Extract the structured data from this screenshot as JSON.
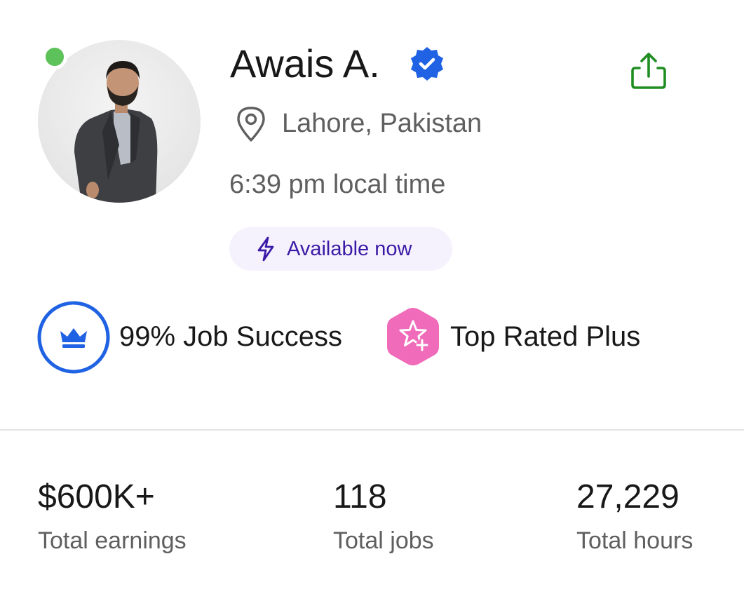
{
  "profile": {
    "name": "Awais A.",
    "location": "Lahore, Pakistan",
    "local_time": "6:39 pm local time",
    "availability": "Available now",
    "online": true,
    "verified": true
  },
  "badges": {
    "job_success": "99% Job Success",
    "job_success_fraction": 0.99,
    "top_rated": "Top Rated Plus"
  },
  "stats": [
    {
      "value": "$600K+",
      "label": "Total earnings"
    },
    {
      "value": "118",
      "label": "Total jobs"
    },
    {
      "value": "27,229",
      "label": "Total hours"
    }
  ],
  "icons": {
    "verified": "verified-badge-icon",
    "share": "share-icon",
    "location": "map-pin-icon",
    "availability": "lightning-bolt-icon",
    "job_success": "crown-icon",
    "top_rated": "star-plus-icon"
  },
  "colors": {
    "online": "#5ec25a",
    "verified": "#1f62e3",
    "share": "#1f8d21",
    "availability_bg": "#f5f2fd",
    "availability_text": "#3b1aa6",
    "job_success": "#1f62e3",
    "top_rated": "#f06bb9"
  }
}
